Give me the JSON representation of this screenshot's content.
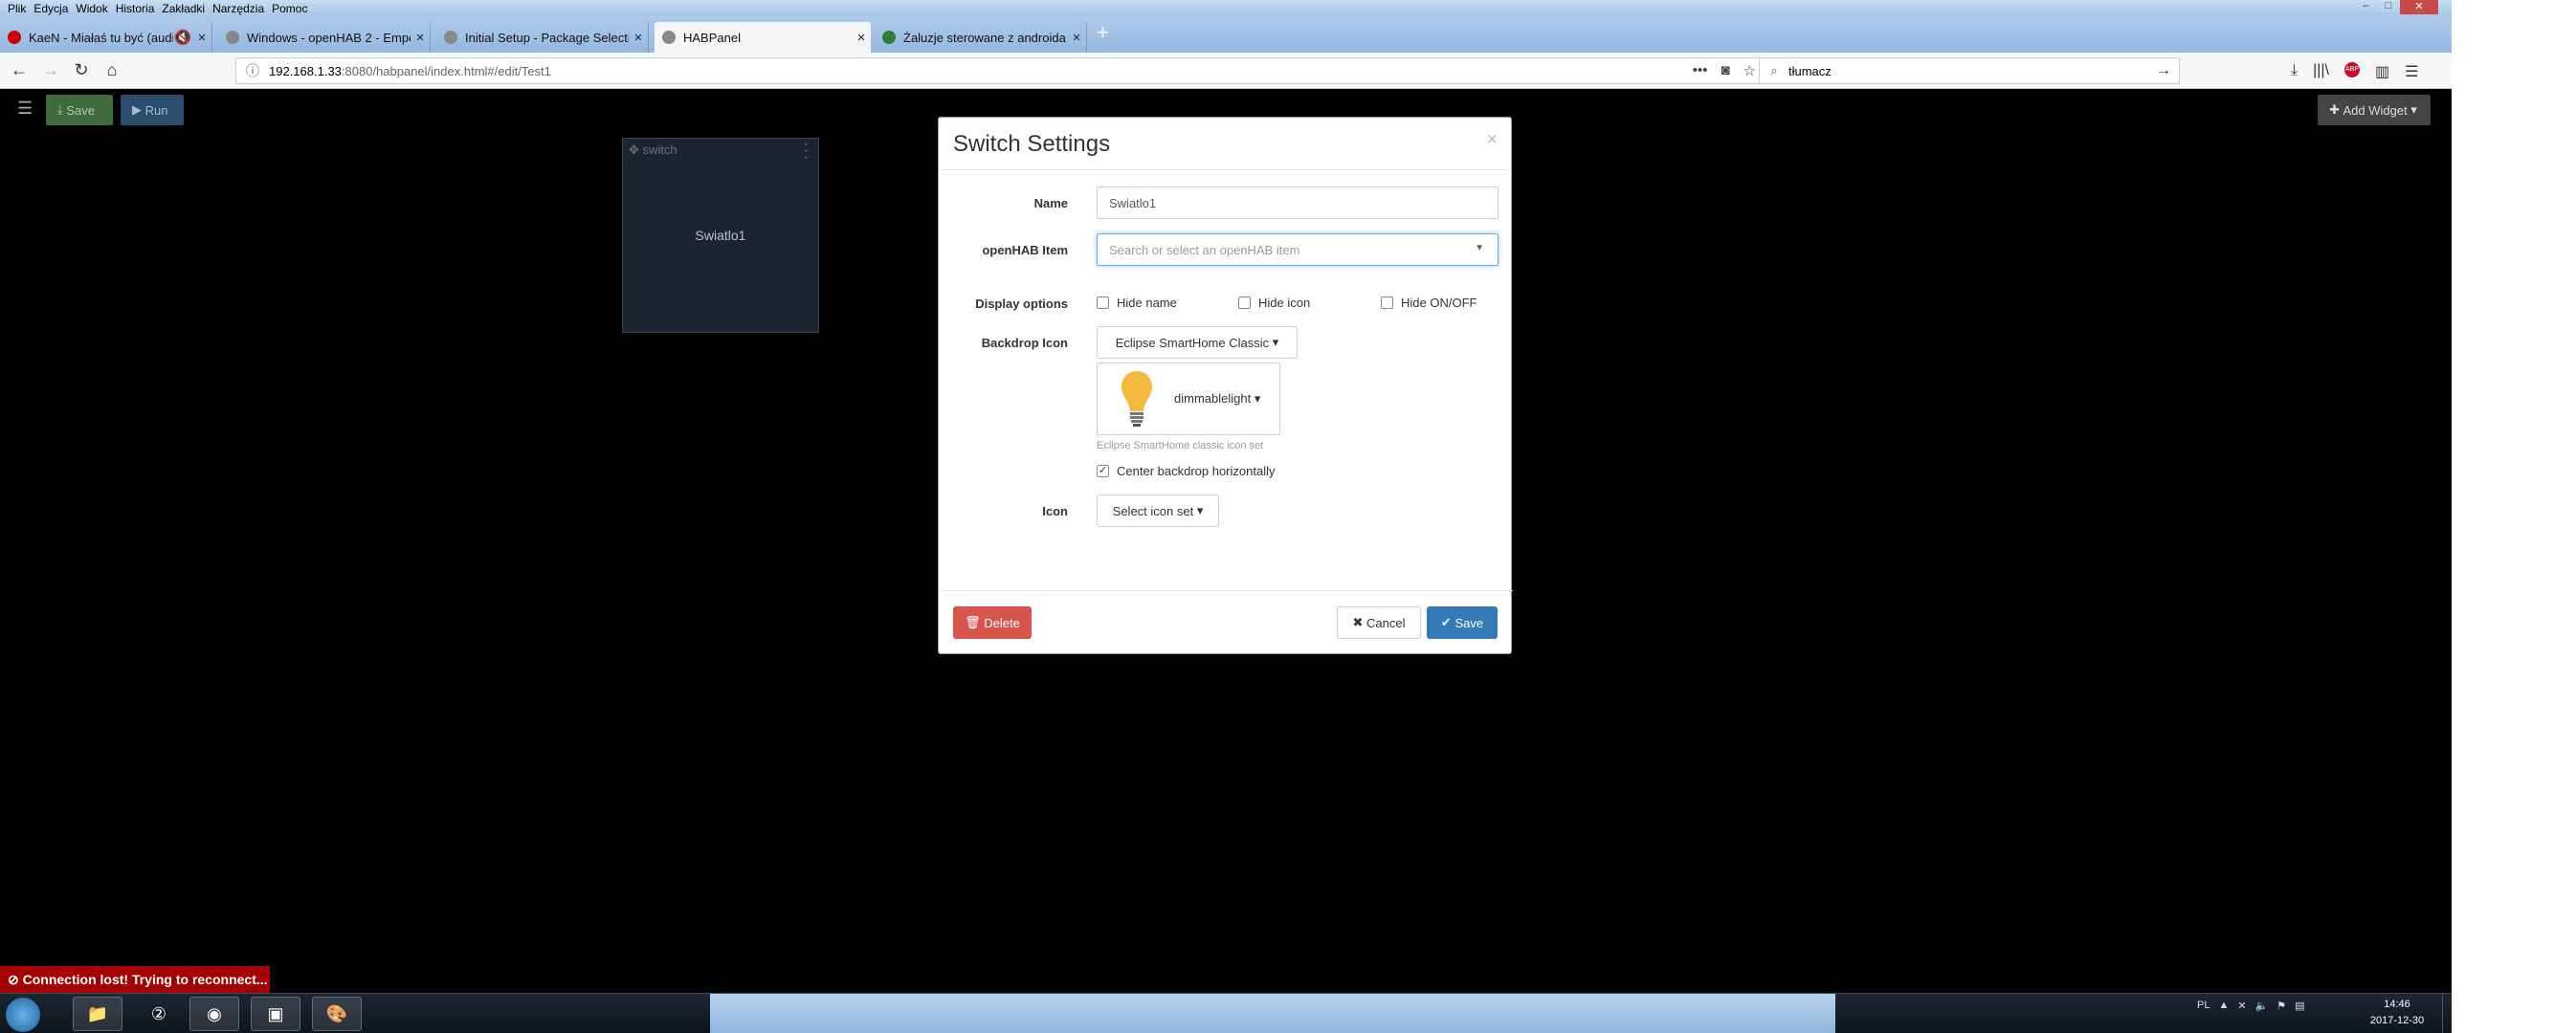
{
  "browser": {
    "menu": [
      "Plik",
      "Edycja",
      "Widok",
      "Historia",
      "Zakładki",
      "Narzędzia",
      "Pomoc"
    ],
    "tabs": [
      {
        "title": "KaeN - Miałaś tu być (audio",
        "favicon_color": "#cc0000",
        "active": false
      },
      {
        "title": "Windows - openHAB 2 - Empo",
        "favicon_color": "#888888",
        "active": false
      },
      {
        "title": "Initial Setup - Package Selectio",
        "favicon_color": "#888888",
        "active": false
      },
      {
        "title": "HABPanel",
        "favicon_color": "#888888",
        "active": true
      },
      {
        "title": "Żaluzje sterowane z androida -",
        "favicon_color": "#2e7d32",
        "active": false
      }
    ],
    "url_host": "192.168.1.33",
    "url_path": ":8080/habpanel/index.html#/edit/Test1",
    "search_value": "tłumacz"
  },
  "toolbar": {
    "save_label": "Save",
    "run_label": "Run",
    "add_widget_label": "Add Widget"
  },
  "widget": {
    "type_label": "switch",
    "name": "Swiatlo1"
  },
  "dialog": {
    "title": "Switch Settings",
    "name_label": "Name",
    "name_value": "Swiatlo1",
    "item_label": "openHAB Item",
    "item_placeholder": "Search or select an openHAB item",
    "display_label": "Display options",
    "opt_hide_name": "Hide name",
    "opt_hide_icon": "Hide icon",
    "opt_hide_onoff": "Hide ON/OFF",
    "backdrop_label": "Backdrop Icon",
    "backdrop_set": "Eclipse SmartHome Classic",
    "backdrop_icon": "dimmablelight",
    "backdrop_help": "Eclipse SmartHome classic icon set",
    "center_label": "Center backdrop horizontally",
    "center_checked": true,
    "icon_label": "Icon",
    "icon_set": "Select icon set",
    "delete_label": "Delete",
    "cancel_label": "Cancel",
    "save_label": "Save"
  },
  "status": {
    "connection": "Connection lost! Trying to reconnect..."
  },
  "taskbar": {
    "lang": "PL",
    "time": "14:46",
    "date": "2017-12-30"
  }
}
